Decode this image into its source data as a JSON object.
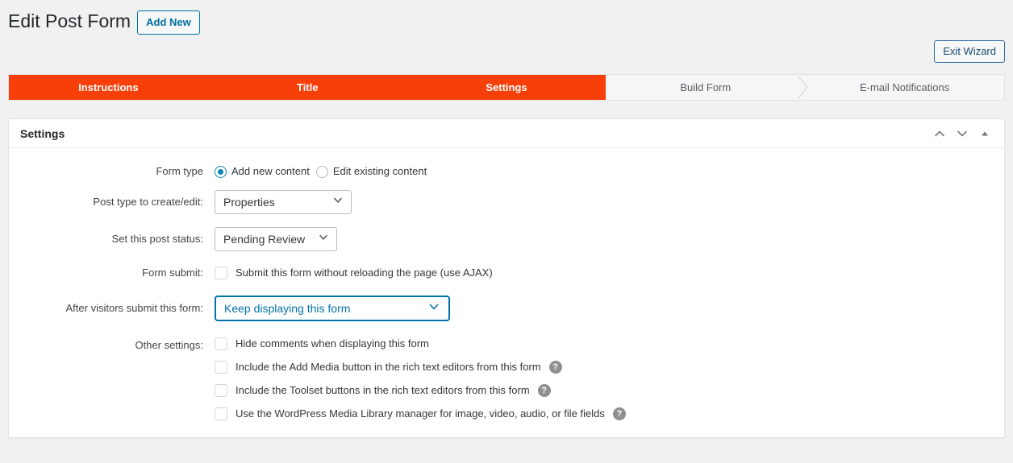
{
  "header": {
    "title": "Edit Post Form",
    "add_new_label": "Add New",
    "exit_wizard_label": "Exit Wizard"
  },
  "wizard": {
    "steps": [
      {
        "label": "Instructions",
        "state": "done"
      },
      {
        "label": "Title",
        "state": "done"
      },
      {
        "label": "Settings",
        "state": "done"
      },
      {
        "label": "Build Form",
        "state": "todo"
      },
      {
        "label": "E-mail Notifications",
        "state": "todo"
      }
    ],
    "active_color": "#f93f09",
    "inactive_color": "#f6f6f6"
  },
  "panel": {
    "title": "Settings",
    "actions": [
      {
        "name": "move-up",
        "glyph": "⌃"
      },
      {
        "name": "move-down",
        "glyph": "⌄"
      },
      {
        "name": "collapse",
        "glyph": "▲"
      }
    ]
  },
  "form": {
    "form_type": {
      "label": "Form type",
      "options": [
        {
          "label": "Add new content",
          "checked": true
        },
        {
          "label": "Edit existing content",
          "checked": false
        }
      ]
    },
    "post_type": {
      "label": "Post type to create/edit:",
      "value": "Properties",
      "options": [
        "Properties"
      ]
    },
    "post_status": {
      "label": "Set this post status:",
      "value": "Pending Review",
      "options": [
        "Pending Review"
      ]
    },
    "form_submit": {
      "label": "Form submit:",
      "checkbox_label": "Submit this form without reloading the page (use AJAX)",
      "checked": false
    },
    "after_submit": {
      "label": "After visitors submit this form:",
      "value": "Keep displaying this form",
      "options": [
        "Keep displaying this form"
      ],
      "focused": true,
      "accent": "#0073aa"
    },
    "other_settings": {
      "label": "Other settings:",
      "items": [
        {
          "label": "Hide comments when displaying this form",
          "checked": false,
          "help": false
        },
        {
          "label": "Include the Add Media button in the rich text editors from this form",
          "checked": false,
          "help": true
        },
        {
          "label": "Include the Toolset buttons in the rich text editors from this form",
          "checked": false,
          "help": true
        },
        {
          "label": "Use the WordPress Media Library manager for image, video, audio, or file fields",
          "checked": false,
          "help": true
        }
      ],
      "help_glyph": "?"
    }
  }
}
